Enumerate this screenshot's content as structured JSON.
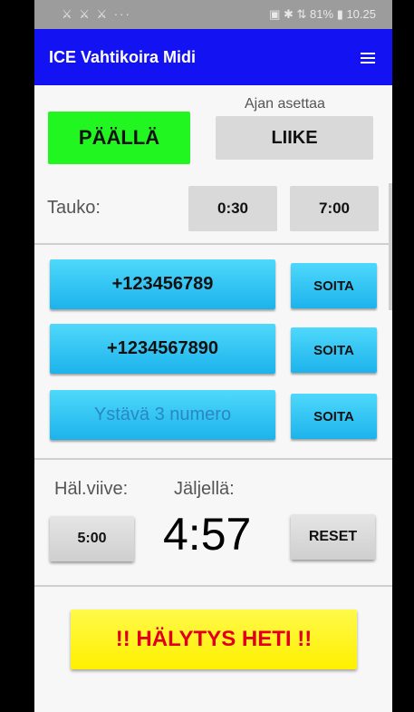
{
  "status_bar": {
    "left_icons": "⚔ ⚔ ⚔ ···",
    "right": "▣ ✱ ⇅ 81% ▮ 10.25"
  },
  "app_bar": {
    "title": "ICE Vahtikoira Midi",
    "menu_icon": "hamburger-menu-icon"
  },
  "mode": {
    "status_label": "PÄÄLLÄ",
    "timer_source_caption": "Ajan asettaa",
    "timer_source_value": "LIIKE",
    "status_color": "#21f621"
  },
  "pause": {
    "label": "Tauko:",
    "value1": "0:30",
    "value2": "7:00"
  },
  "contacts": [
    {
      "number": "+123456789",
      "call_label": "SOITA"
    },
    {
      "number": "+1234567890",
      "call_label": "SOITA"
    },
    {
      "number": "Ystävä 3 numero",
      "call_label": "SOITA"
    }
  ],
  "alarm_delay": {
    "label": "Häl.viive:",
    "value": "5:00"
  },
  "remaining": {
    "label": "Jäljellä:",
    "value": "4:57",
    "reset_label": "RESET"
  },
  "alarm_button": {
    "label": "!! HÄLYTYS HETI !!",
    "text_color": "#e0001b",
    "bg_color": "#fff94a"
  },
  "colors": {
    "app_bar": "#1212f2",
    "phone_button": "#1cb3ec"
  }
}
